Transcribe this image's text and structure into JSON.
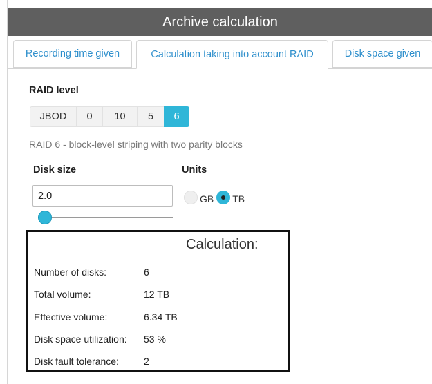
{
  "window": {
    "title": "Archive calculation"
  },
  "tabs": [
    {
      "label": "Recording time given",
      "active": false
    },
    {
      "label": "Calculation taking into account RAID",
      "active": true
    },
    {
      "label": "Disk space given",
      "active": false
    }
  ],
  "raid": {
    "label": "RAID level",
    "options": [
      "JBOD",
      "0",
      "10",
      "5",
      "6"
    ],
    "selected": "6",
    "description": "RAID 6 - block-level striping with two parity blocks"
  },
  "disk_size": {
    "label": "Disk size",
    "value": "2.0",
    "slider_fraction": 0.0
  },
  "units": {
    "label": "Units",
    "options": [
      "GB",
      "TB"
    ],
    "selected": "TB"
  },
  "calculation": {
    "title": "Calculation:",
    "rows": [
      {
        "label": "Number of disks:",
        "value": "6"
      },
      {
        "label": "Total volume:",
        "value": "12 TB"
      },
      {
        "label": "Effective volume:",
        "value": "6.34 TB"
      },
      {
        "label": "Disk space utilization:",
        "value": "53 %"
      },
      {
        "label": "Disk fault tolerance:",
        "value": "2"
      }
    ]
  },
  "colors": {
    "accent": "#2fb6d8",
    "title_bar": "#5f5f5f",
    "tab_text": "#2e8fcc"
  }
}
